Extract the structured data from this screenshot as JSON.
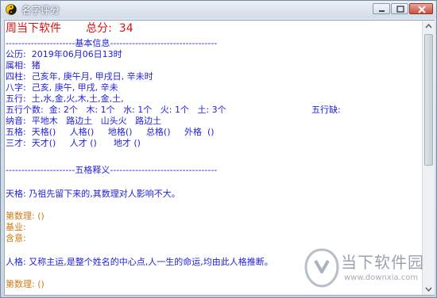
{
  "window": {
    "title": "名字评分"
  },
  "header": {
    "brand": "周当下软件",
    "score_label": "总分:",
    "score_value": "34"
  },
  "sections": {
    "basic_info": "----------------------基本信息----------------------------------",
    "five_grid": "----------------------五格释义----------------------------------"
  },
  "info": {
    "solar": "公历:  2019年06月06日13时",
    "zodiac": "属相:  猪",
    "pillars": "四柱:  己亥年, 庚午月, 甲戌日, 辛未时",
    "bazi": "八字:  己亥, 庚午, 甲戌, 辛未",
    "wuxing": "五行:  土,水,金,火,木,土,金,土,",
    "wuxing_count": "五行个数:  金: 2个   木: 1个   水: 1个   火: 1个   土: 3个",
    "wuxing_missing": "五行缺:",
    "nayin": "纳音:  平地木   路边土   山头火   路边土",
    "five_grids": "五格:  天格()     人格()     地格()     总格()     外格  ()",
    "three_talents": "三才:  天才()     人才 ()      地才 ()"
  },
  "explain": {
    "tian": "天格: 乃祖先留下来的,其数理对人影响不大。",
    "number_label_1": "第数理: ()",
    "foundation_label": "基业:",
    "meaning_label": "含意:",
    "ren": "人格: 又称主运,是整个姓名的中心点,人一生的命运,均由此人格推断。",
    "number_label_2": "第数理: ()"
  },
  "watermark": {
    "name": "当下软件园",
    "url": "www.downxia.com"
  },
  "colors": {
    "text_blue": "#2020e0",
    "accent_red": "#e01010",
    "label_orange": "#d07a10"
  },
  "icons": [
    "app-yinyang-icon",
    "minimize-icon",
    "maximize-icon",
    "close-icon",
    "scroll-up-icon",
    "scroll-down-icon",
    "watermark-logo-icon"
  ]
}
